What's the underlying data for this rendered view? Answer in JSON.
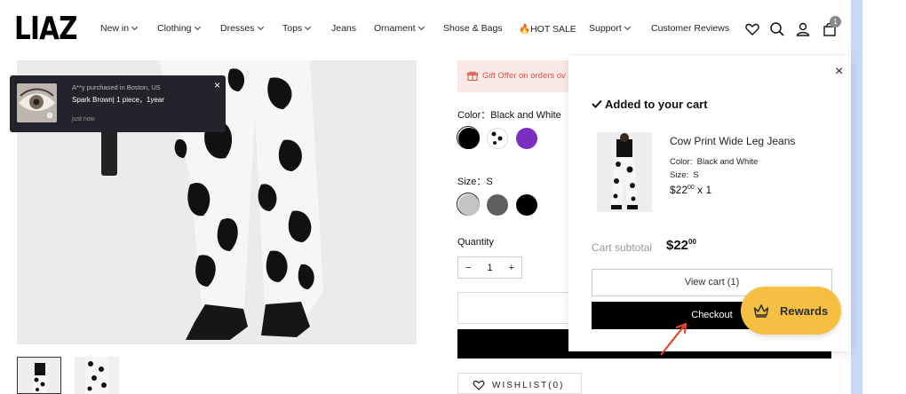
{
  "brand": {
    "logo": "LIAZ"
  },
  "nav": {
    "items": [
      {
        "label": "New in",
        "dropdown": true
      },
      {
        "label": "Clothing",
        "dropdown": true
      },
      {
        "label": "Dresses",
        "dropdown": true
      },
      {
        "label": "Tops",
        "dropdown": true
      },
      {
        "label": "Jeans",
        "dropdown": false
      },
      {
        "label": "Ornament",
        "dropdown": true
      },
      {
        "label": "Shose & Bags",
        "dropdown": false
      },
      {
        "label": "🔥HOT SALE",
        "dropdown": false
      },
      {
        "label": "Support",
        "dropdown": true
      },
      {
        "label": "Customer Reviews",
        "dropdown": false
      }
    ],
    "icons": [
      "heart-icon",
      "search-icon",
      "user-icon",
      "cart-icon"
    ],
    "cart_count": "1"
  },
  "notification": {
    "line1": "A**y purchased in Boston, US",
    "line2": "Spark Brown| 1 piece，1year",
    "line3": "just now",
    "close": "×"
  },
  "product": {
    "gift_text": "Gift Offer on orders ov",
    "color_label": "Color：Black and White",
    "colors": [
      {
        "name": "black",
        "hex": "#000000"
      },
      {
        "name": "cow-print",
        "hex": "#ffffff"
      },
      {
        "name": "purple",
        "hex": "#7b2fbf"
      }
    ],
    "size_label": "Size：S",
    "sizes": [
      {
        "name": "light-gray",
        "hex": "#c4c4c4"
      },
      {
        "name": "gray",
        "hex": "#5e5e5e"
      },
      {
        "name": "black",
        "hex": "#000000"
      }
    ],
    "quantity_label": "Quantity",
    "quantity": {
      "minus": "−",
      "value": "1",
      "plus": "+"
    },
    "wishlist": "WISHLIST(0)"
  },
  "cart_drawer": {
    "close": "×",
    "added_title": "Added to your cart",
    "item": {
      "name": "Cow Print Wide Leg Jeans",
      "color_label": "Color:",
      "color_value": "Black and White",
      "size_label": "Size:",
      "size_value": "S",
      "price_main": "$22",
      "price_cents": "00",
      "qty": "x 1"
    },
    "subtotal_label": "Cart subtotal",
    "subtotal_main": "$22",
    "subtotal_cents": "00",
    "view_cart": "View cart (1)",
    "checkout": "Checkout"
  },
  "rewards": {
    "label": "Rewards"
  },
  "colors": {
    "accent_red": "#e2513b",
    "rewards_yellow": "#f5c041",
    "annotation_arrow": "#e8472f"
  }
}
